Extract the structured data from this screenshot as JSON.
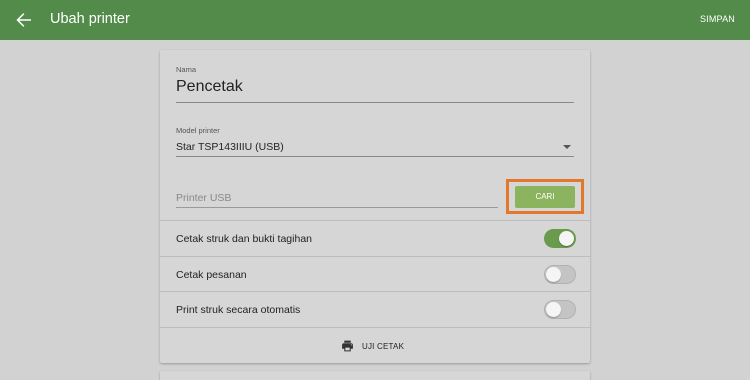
{
  "appbar": {
    "title": "Ubah printer",
    "save_label": "SIMPAN",
    "back_icon": "arrow-back-icon",
    "bg_color": "#538c4a"
  },
  "form": {
    "name_label": "Nama",
    "name_value": "Pencetak",
    "model_label": "Model printer",
    "model_value": "Star TSP143IIIU (USB)",
    "usb_placeholder": "Printer USB",
    "usb_value": "",
    "search_label": "CARI",
    "search_color": "#8cb45e",
    "highlight_color": "#e3772c"
  },
  "settings": [
    {
      "label": "Cetak struk dan bukti tagihan",
      "enabled": true
    },
    {
      "label": "Cetak pesanan",
      "enabled": false
    },
    {
      "label": "Print struk secara otomatis",
      "enabled": false
    }
  ],
  "test_print": {
    "label": "UJI CETAK",
    "icon": "printer-icon"
  }
}
